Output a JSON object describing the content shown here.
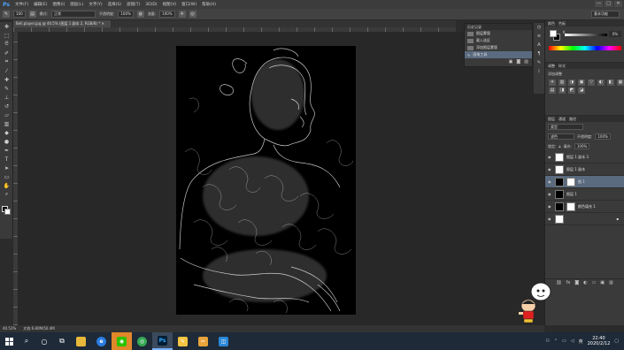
{
  "app": {
    "logo": "Ps",
    "menus": [
      "文件(F)",
      "编辑(E)",
      "图像(I)",
      "图层(L)",
      "文字(Y)",
      "选择(S)",
      "滤镜(T)",
      "3D(D)",
      "视图(V)",
      "窗口(W)",
      "帮助(H)"
    ],
    "window_controls": [
      "—",
      "□",
      "✕"
    ]
  },
  "options": {
    "brush_size": "100",
    "mode_label": "模式:",
    "mode_value": "正常",
    "opacity_label": "不透明度:",
    "opacity_value": "100%",
    "flow_label": "流量:",
    "flow_value": "100%",
    "workspace": "基本功能"
  },
  "document": {
    "tab_title": "Bell.player.jpg @ 40.5% (图层 1 副本 2, RGB/8) * ✕",
    "zoom": "40.53%",
    "doc_size": "文档:6.80M/50.4M"
  },
  "history": {
    "title": "历史记录",
    "items": [
      {
        "label": "图层蒙版"
      },
      {
        "label": "载入选区"
      },
      {
        "label": "添加图层蒙版"
      },
      {
        "label": "画笔工具"
      }
    ]
  },
  "color_panel": {
    "tabs": [
      "颜色",
      "色板"
    ],
    "k_label": "K",
    "k_value": "0",
    "k_unit": "%"
  },
  "adjustments": {
    "tabs": [
      "调整",
      "样式"
    ],
    "title": "添加调整",
    "icons": [
      "☀",
      "▥",
      "◑",
      "▣",
      "▽",
      "◐",
      "◧",
      "▦",
      "▤",
      "◨",
      "◩",
      "◪"
    ]
  },
  "layers": {
    "tabs": [
      "图层",
      "通道",
      "路径"
    ],
    "kind": "类型",
    "blend": "滤色",
    "opacity_label": "不透明度:",
    "opacity": "100%",
    "lock_label": "锁定:",
    "fill_label": "填充:",
    "fill": "100%",
    "rows": [
      {
        "name": "图层 1 副本 3",
        "thumb": "white",
        "active": false,
        "mask": false
      },
      {
        "name": "图层 1 副本",
        "thumb": "white",
        "active": false,
        "mask": false
      },
      {
        "name": "图 1",
        "thumb": "black",
        "active": true,
        "mask": true
      },
      {
        "name": "图层 1",
        "thumb": "black",
        "active": false,
        "mask": false
      },
      {
        "name": "颜色填充 1",
        "thumb": "black",
        "active": false,
        "mask": true
      },
      {
        "name": "",
        "thumb": "white",
        "active": false,
        "mask": false
      }
    ]
  },
  "taskbar": {
    "clock_time": "22:40",
    "clock_date": "2020/2/12",
    "lang": "英"
  }
}
